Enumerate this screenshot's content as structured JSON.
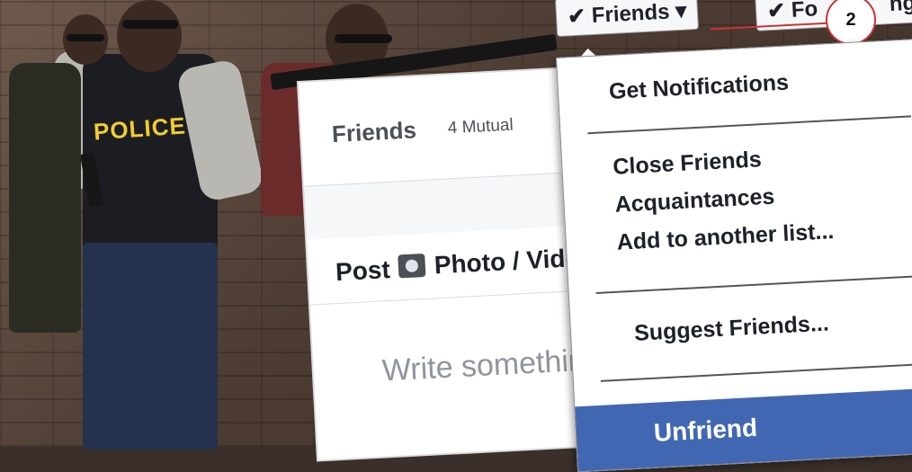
{
  "profile_card": {
    "friends_title": "Friends",
    "mutual_count": "4 Mutual",
    "post_tab": "Post",
    "photo_tab": "Photo / Vide",
    "composer_placeholder": "Write somethin"
  },
  "top_buttons": {
    "friends_label": "✔ Friends ▾",
    "following_label": "✔ Fo",
    "following_tail": "ng",
    "badge_number": "2"
  },
  "dropdown_menu": {
    "items": [
      "Get Notifications",
      "Close Friends",
      "Acquaintances",
      "Add to another list...",
      "Suggest Friends...",
      "Unfriend"
    ]
  },
  "background": {
    "vest_text": "POLICE"
  },
  "colors": {
    "facebook_blue": "#4267b2",
    "badge_border": "#cc3333",
    "police_yellow": "#f2cd2f"
  }
}
